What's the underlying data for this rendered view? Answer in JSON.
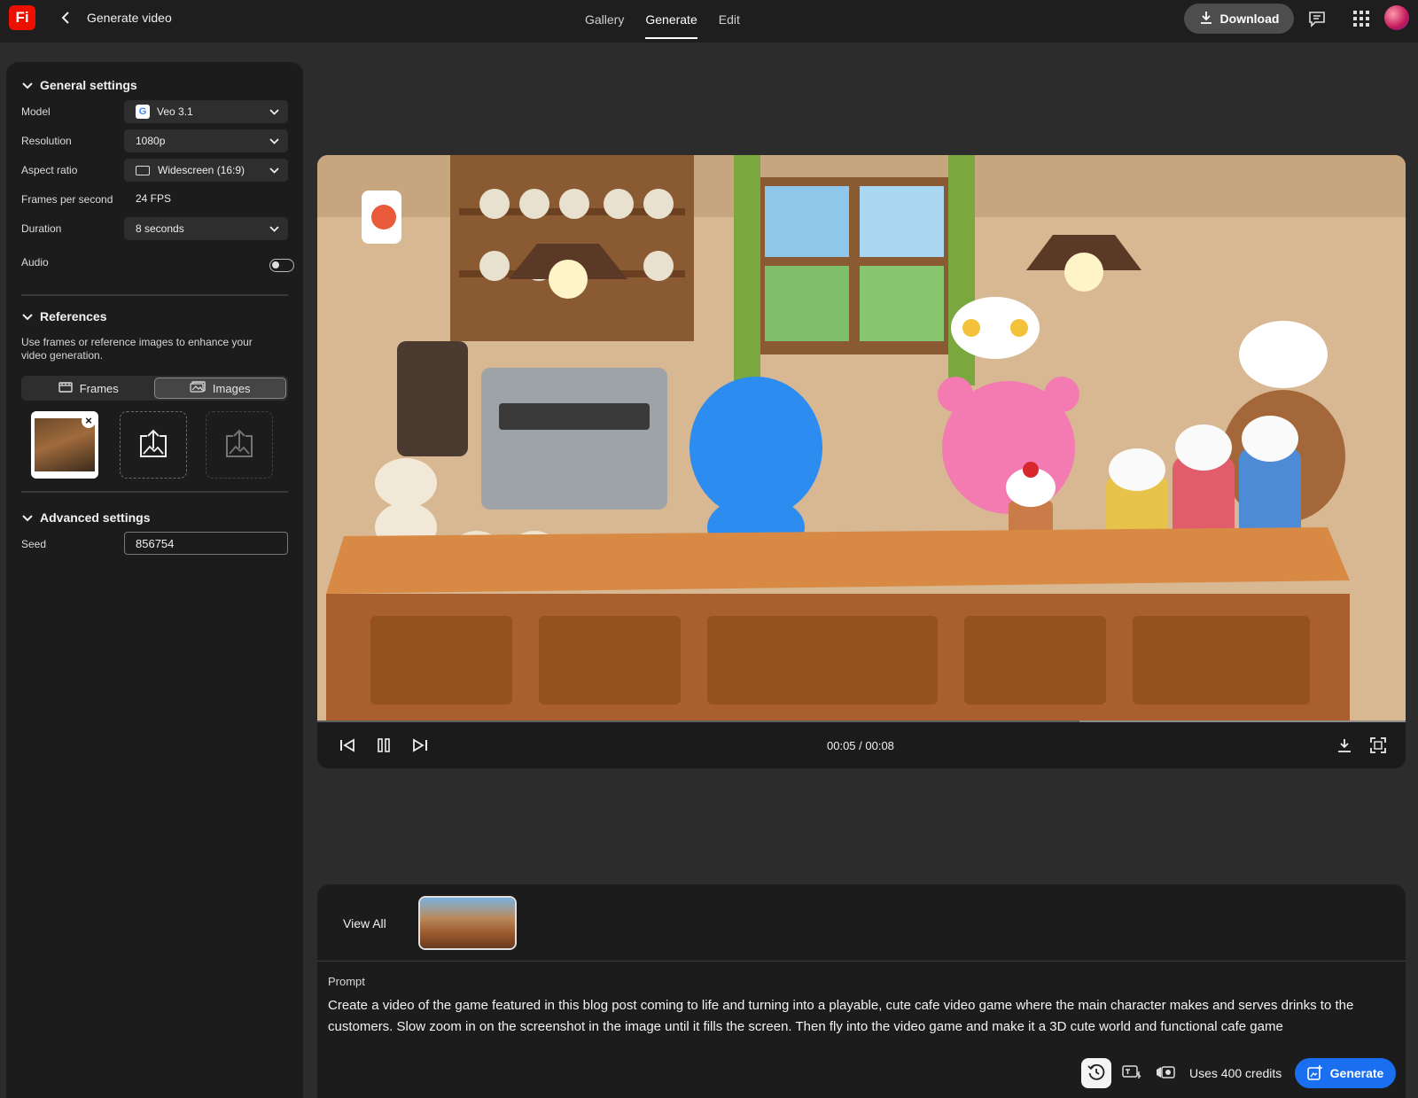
{
  "app": {
    "logo_text": "Fi",
    "page_title": "Generate video",
    "tabs": [
      {
        "label": "Gallery",
        "active": false
      },
      {
        "label": "Generate",
        "active": true
      },
      {
        "label": "Edit",
        "active": false
      }
    ],
    "download_label": "Download",
    "accent_color": "#1a6ef0",
    "logo_color": "#eb1000"
  },
  "general_settings": {
    "title": "General settings",
    "model_label": "Model",
    "model_value": "Veo 3.1",
    "model_icon": "google-icon",
    "resolution_label": "Resolution",
    "resolution_value": "1080p",
    "aspect_label": "Aspect ratio",
    "aspect_value": "Widescreen (16:9)",
    "fps_label": "Frames per second",
    "fps_value": "24 FPS",
    "duration_label": "Duration",
    "duration_value": "8 seconds",
    "audio_label": "Audio",
    "audio_on": false
  },
  "references": {
    "title": "References",
    "description": "Use frames or reference images to enhance your video generation.",
    "frames_label": "Frames",
    "images_label": "Images",
    "active_tab": "Images"
  },
  "advanced_settings": {
    "title": "Advanced settings",
    "seed_label": "Seed",
    "seed_value": "856754"
  },
  "player": {
    "timecode": "00:05 / 00:08",
    "progress": 0.7
  },
  "bottom": {
    "view_all": "View All",
    "prompt_label": "Prompt",
    "prompt_text": "Create a video of the game featured in this blog post coming to life and turning into a playable, cute cafe video game where the main character makes and serves drinks to the customers. Slow zoom in on the screenshot in the image until it fills the screen. Then fly into the video game and make it a 3D cute world and functional cafe game",
    "credits": "Uses 400 credits",
    "generate_label": "Generate"
  }
}
